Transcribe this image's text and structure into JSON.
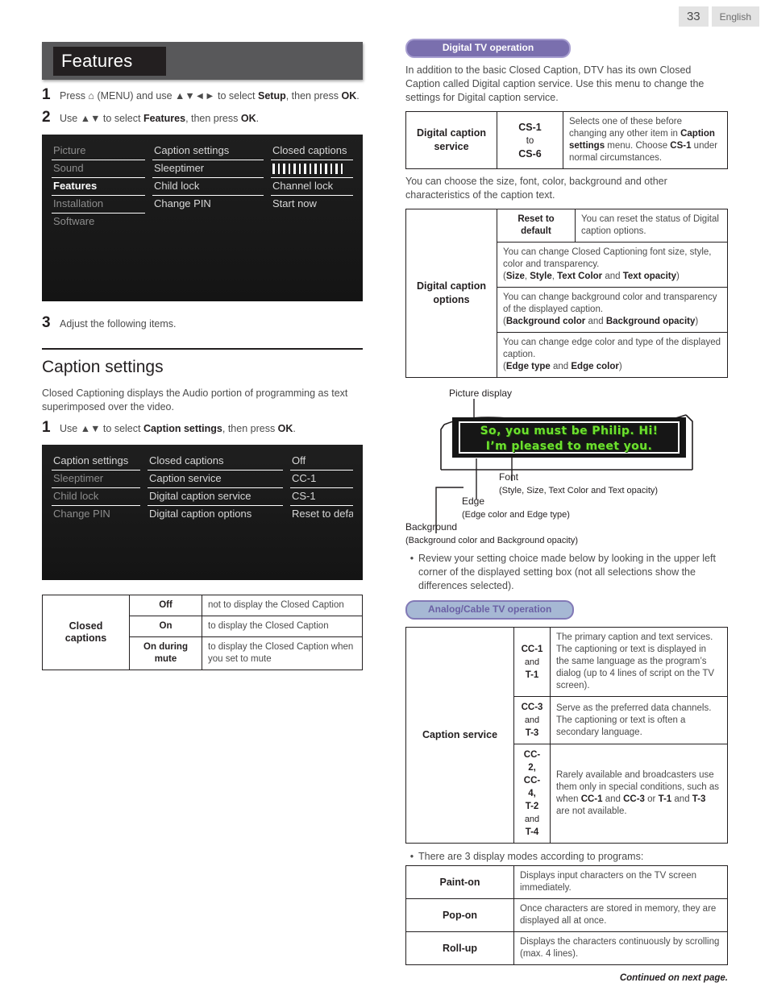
{
  "page": {
    "number": "33",
    "language": "English"
  },
  "left": {
    "title": "Features",
    "steps": [
      {
        "num": "1",
        "html": "Press ⌂ (MENU) and use ▲▼◄► to select <b>Setup</b>, then press <b>OK</b>."
      },
      {
        "num": "2",
        "html": "Use ▲▼ to select <b>Features</b>, then press <b>OK</b>."
      }
    ],
    "osd1": {
      "col1": [
        "Picture",
        "Sound",
        "Features",
        "Installation",
        "Software"
      ],
      "col2": [
        "Caption settings",
        "Sleeptimer",
        "Child lock",
        "Change PIN"
      ],
      "col3": [
        "Closed captions",
        "",
        "Channel lock",
        "Start now"
      ],
      "selected": "Features",
      "bar_count": 14
    },
    "step3": {
      "num": "3",
      "html": "Adjust the following items."
    },
    "section_title": "Caption settings",
    "section_body": "Closed Captioning displays the Audio portion of programming as text superimposed over the video.",
    "section_step": {
      "num": "1",
      "html": "Use ▲▼ to select <b>Caption settings</b>, then press <b>OK</b>."
    },
    "osd2": {
      "col1": [
        "Caption settings",
        "Sleeptimer",
        "Child lock",
        "Change PIN"
      ],
      "col2": [
        "Closed captions",
        "Caption service",
        "Digital caption service",
        "Digital caption options"
      ],
      "col3": [
        "Off",
        "CC-1",
        "CS-1",
        "Reset to default"
      ],
      "selected": "Caption settings"
    },
    "cc_table": {
      "row_label": "Closed captions",
      "rows": [
        {
          "value": "Off",
          "desc": "not to display the Closed Caption"
        },
        {
          "value": "On",
          "desc": "to display the Closed Caption"
        },
        {
          "value": "On during mute",
          "desc": "to display the Closed Caption when you set to mute"
        }
      ]
    }
  },
  "right": {
    "digital_badge": "Digital TV operation",
    "digital_intro": "In addition to the basic Closed Caption, DTV has its own Closed Caption called Digital caption service. Use this menu to change the settings for Digital caption service.",
    "digital_service_table": {
      "label": "Digital caption\nservice",
      "label_line1": "Digital caption",
      "label_line2": "service",
      "value_line1": "CS-1",
      "value_line2": "to",
      "value_line3": "CS-6",
      "desc_html": "Selects one of these before changing any other item in <b>Caption settings</b> menu. Choose <b>CS-1</b> under normal circumstances."
    },
    "options_intro": "You can choose the size, font, color, background and other characteristics of the caption text.",
    "digital_options_table": {
      "label_line1": "Digital caption",
      "label_line2": "options",
      "reset_label": "Reset to default",
      "reset_desc": "You can reset the status of Digital caption options.",
      "rows": [
        "You can change Closed Captioning font size, style, color and transparency.<br>(<b>Size</b>, <b>Style</b>, <b>Text Color</b> and <b>Text opacity</b>)",
        "You can change background color and transparency of the displayed caption.<br>(<b>Background color</b> and <b>Background opacity</b>)",
        "You can change edge color and type of the displayed caption.<br>(<b>Edge type</b> and <b>Edge color</b>)"
      ]
    },
    "diagram": {
      "picture_display": "Picture display",
      "caption_line1": "So, you must be Philip. Hi!",
      "caption_line2": "I’m pleased to meet you.",
      "font_label": "Font",
      "font_sub": "(Style, Size, Text Color and Text opacity)",
      "edge_label": "Edge",
      "edge_sub": "(Edge color and Edge type)",
      "background_label": "Background",
      "background_sub": "(Background color and Background opacity)",
      "caption_color": "#6de02e"
    },
    "review_bullet": "Review your setting choice made below by looking in the upper left corner of the displayed setting box (not all selections show the differences selected).",
    "analog_badge": "Analog/Cable TV operation",
    "caption_service_table": {
      "label": "Caption service",
      "rows": [
        {
          "codes": [
            "CC-1",
            "and",
            "T-1"
          ],
          "desc_html": "The primary caption and text services. The captioning or text is displayed in the same language as the program’s dialog (up to 4 lines of script on the TV screen)."
        },
        {
          "codes": [
            "CC-3",
            "and",
            "T-3"
          ],
          "desc_html": "Serve as the preferred data channels. The captioning or text is often a secondary language."
        },
        {
          "codes": [
            "CC-2,",
            "CC-4,",
            "T-2",
            "and",
            "T-4"
          ],
          "desc_html": "Rarely available and broadcasters use them only in special conditions, such as when <b>CC-1</b> and <b>CC-3</b> or <b>T-1</b> and <b>T-3</b> are not available."
        }
      ]
    },
    "modes_bullet": "There are 3 display modes according to programs:",
    "modes_table": [
      {
        "mode": "Paint-on",
        "desc": "Displays input characters on the TV screen immediately."
      },
      {
        "mode": "Pop-on",
        "desc": "Once characters are stored in memory, they are displayed all at once."
      },
      {
        "mode": "Roll-up",
        "desc": "Displays the characters continuously by scrolling (max. 4 lines)."
      }
    ],
    "continued": "Continued on next page."
  }
}
